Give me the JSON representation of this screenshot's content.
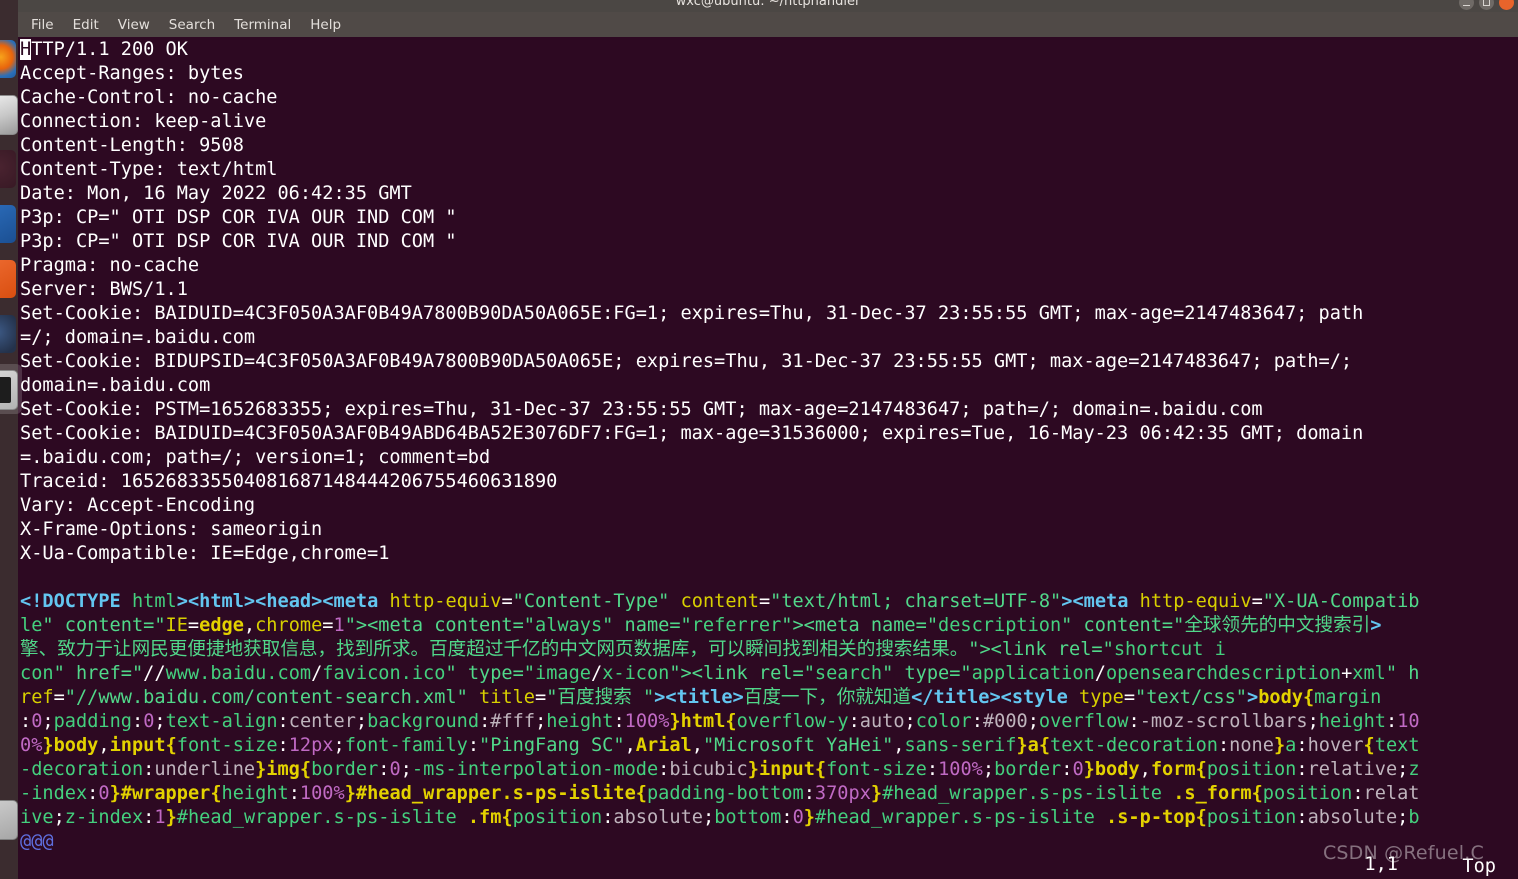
{
  "window": {
    "title": "wxc@ubuntu: ~/httphandler",
    "controls": [
      {
        "name": "minimize",
        "label": "−"
      },
      {
        "name": "maximize",
        "label": "□"
      },
      {
        "name": "close",
        "label": "×"
      }
    ]
  },
  "menubar": {
    "items": [
      {
        "label": "File"
      },
      {
        "label": "Edit"
      },
      {
        "label": "View"
      },
      {
        "label": "Search"
      },
      {
        "label": "Terminal"
      },
      {
        "label": "Help"
      }
    ]
  },
  "launcher": {
    "icons": [
      {
        "name": "firefox-icon"
      },
      {
        "name": "files-icon"
      },
      {
        "name": "amazon-icon"
      },
      {
        "name": "software-center-icon"
      },
      {
        "name": "ubuntu-software-icon"
      },
      {
        "name": "help-icon"
      },
      {
        "name": "terminal-icon"
      },
      {
        "name": "trash-icon"
      }
    ]
  },
  "terminal": {
    "http_response": {
      "status_line": "HTTP/1.1 200 OK",
      "headers": [
        "Accept-Ranges: bytes",
        "Cache-Control: no-cache",
        "Connection: keep-alive",
        "Content-Length: 9508",
        "Content-Type: text/html",
        "Date: Mon, 16 May 2022 06:42:35 GMT",
        "P3p: CP=\" OTI DSP COR IVA OUR IND COM \"",
        "P3p: CP=\" OTI DSP COR IVA OUR IND COM \"",
        "Pragma: no-cache",
        "Server: BWS/1.1",
        "Set-Cookie: BAIDUID=4C3F050A3AF0B49A7800B90DA50A065E:FG=1; expires=Thu, 31-Dec-37 23:55:55 GMT; max-age=2147483647; path=/; domain=.baidu.com",
        "Set-Cookie: BIDUPSID=4C3F050A3AF0B49A7800B90DA50A065E; expires=Thu, 31-Dec-37 23:55:55 GMT; max-age=2147483647; path=/; domain=.baidu.com",
        "Set-Cookie: PSTM=1652683355; expires=Thu, 31-Dec-37 23:55:55 GMT; max-age=2147483647; path=/; domain=.baidu.com",
        "Set-Cookie: BAIDUID=4C3F050A3AF0B49ABD64BA52E3076DF7:FG=1; max-age=31536000; expires=Tue, 16-May-23 06:42:35 GMT; domain=.baidu.com; path=/; version=1; comment=bd",
        "Traceid: 1652683355040816871484442067554606318 90",
        "Vary: Accept-Encoding",
        "X-Frame-Options: sameorigin",
        "X-Ua-Compatible: IE=Edge,chrome=1"
      ]
    },
    "body_lines": [
      "<!DOCTYPE html><html><head><meta http-equiv=\"Content-Type\" content=\"text/html; charset=UTF-8\"><meta http-equiv=\"X-UA-Compatib",
      "le\" content=\"IE=edge,chrome=1\"><meta content=\"always\" name=\"referrer\"><meta name=\"description\" content=\"全球领先的中文搜索引>",
      "擎、致力于让网民更便捷地获取信息，找到所求。百度超过千亿的中文网页数据库，可以瞬间找到相关的搜索结果。\"><link rel=\"shortcut i",
      "con\" href=\"//www.baidu.com/favicon.ico\" type=\"image/x-icon\"><link rel=\"search\" type=\"application/opensearchdescription+xml\" h",
      "ref=\"//www.baidu.com/content-search.xml\" title=\"百度搜索 \"><title>百度一下，你就知道</title><style type=\"text/css\">body{margin",
      ":0;padding:0;text-align:center;background:#fff;height:100%}html{overflow-y:auto;color:#000;overflow:-moz-scrollbars;height:10",
      "0%}body,input{font-size:12px;font-family:\"PingFang SC\",Arial,\"Microsoft YaHei\",sans-serif}a{text-decoration:none}a:hover{text",
      "-decoration:underline}img{border:0;-ms-interpolation-mode:bicubic}input{font-size:100%;border:0}body,form{position:relative;z",
      "-index:0}#wrapper{height:100%}#head_wrapper.s-ps-islite{padding-bottom:370px}#head_wrapper.s-ps-islite .s_form{position:relat",
      "ive;z-index:1}#head_wrapper.s-ps-islite .fm{position:absolute;bottom:0}#head_wrapper.s-ps-islite .s-p-top{position:absolute;b"
    ],
    "eof_marker": "@@@"
  },
  "statusline": {
    "position": "1,1",
    "scroll": "Top"
  },
  "watermark": "CSDN @Refuel.C"
}
